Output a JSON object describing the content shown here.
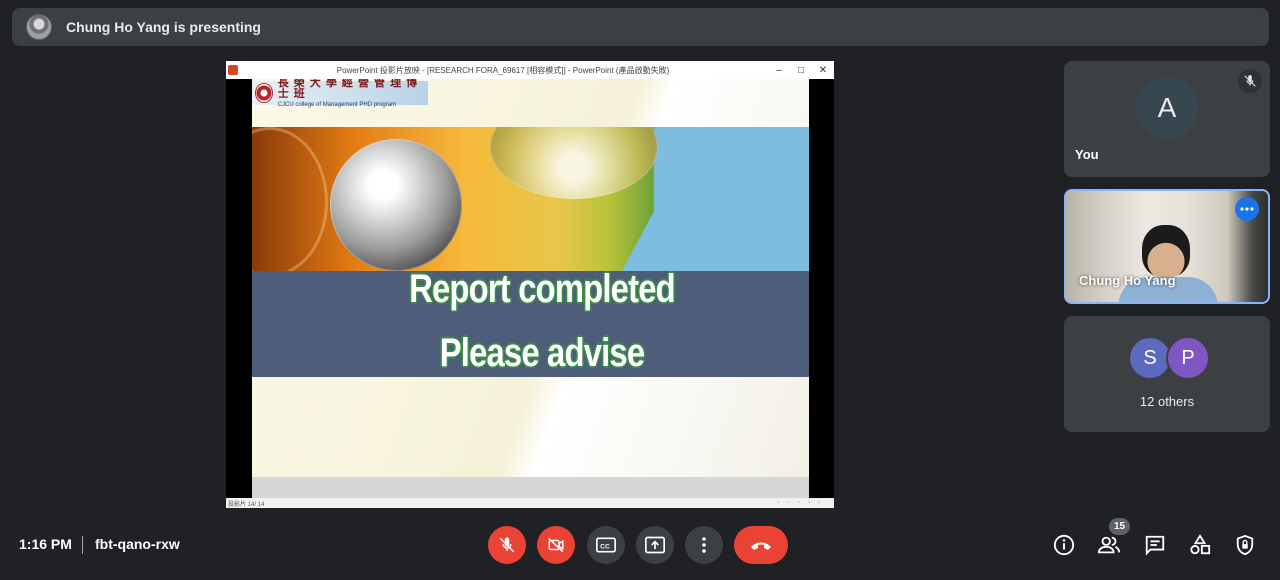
{
  "banner": {
    "presenting_text": "Chung Ho Yang is presenting",
    "icon": "presenter-avatar"
  },
  "shared_screen": {
    "window_title": "PowerPoint 投影片放映 - [RESEARCH FORA_69617 [相容模式]] - PowerPoint (產品啟動失敗)",
    "logo_chinese": "長 榮 大 學 經 營 管 理 博 士 班",
    "logo_english": "CJCU college of Management PHD program",
    "slide_line1": "Report completed",
    "slide_line2": "Please advise",
    "status_left": "投影片 14/ 14",
    "window_controls": [
      "–",
      "□",
      "✕"
    ]
  },
  "participants": {
    "self": {
      "initial": "A",
      "name": "You",
      "mic": "muted"
    },
    "presenter": {
      "name": "Chung Ho Yang"
    },
    "others": {
      "initials": [
        "S",
        "P"
      ],
      "label": "12 others"
    }
  },
  "bottom_bar": {
    "time": "1:16 PM",
    "meeting_code": "fbt-qano-rxw",
    "controls": [
      "mic-off",
      "camera-off",
      "captions",
      "present",
      "more-options",
      "leave-call"
    ],
    "people_count": "15",
    "right_icons": [
      "info",
      "people",
      "chat",
      "activities",
      "host-controls"
    ]
  },
  "colors": {
    "background": "#202124",
    "surface": "#3c4043",
    "danger": "#ea4335",
    "accent": "#8ab4f8"
  }
}
